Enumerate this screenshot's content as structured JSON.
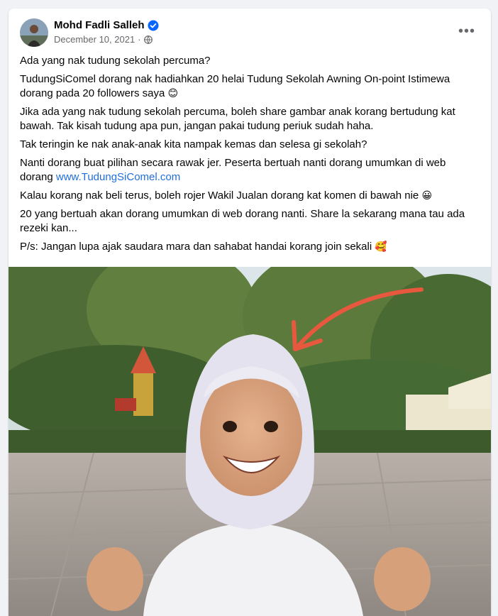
{
  "post": {
    "author": {
      "name": "Mohd Fadli Salleh",
      "verified": true
    },
    "date": "December 10, 2021",
    "privacy_icon": "globe-icon",
    "more_icon": "more-options-icon",
    "more_label": "•••",
    "paragraphs": [
      {
        "text": "Ada yang nak tudung sekolah percuma?"
      },
      {
        "text": "TudungSiComel dorang nak hadiahkan 20 helai Tudung Sekolah Awning On-point Istimewa dorang pada 20 followers saya ",
        "emoji": "😊"
      },
      {
        "text": "Jika ada yang nak tudung sekolah percuma, boleh share gambar anak korang bertudung kat bawah. Tak kisah tudung apa pun, jangan pakai tudung periuk sudah haha."
      },
      {
        "text": "Tak teringin ke nak anak-anak kita nampak kemas dan selesa gi sekolah?"
      },
      {
        "text": "Nanti dorang buat pilihan secara rawak jer. Peserta bertuah nanti dorang umumkan di web dorang ",
        "link": "www.TudungSiComel.com"
      },
      {
        "text": "Kalau korang nak beli terus, boleh rojer Wakil Jualan dorang kat komen di bawah nie ",
        "emoji": "😀"
      },
      {
        "text": "20 yang bertuah akan dorang umumkan di web dorang nanti. Share la sekarang mana tau ada rezeki kan..."
      },
      {
        "text": "P/s: Jangan lupa ajak saudara mara dan sahabat handai korang join sekali ",
        "emoji": "🥰"
      }
    ]
  },
  "colors": {
    "link": "#216fdb",
    "verified_badge": "#0866ff",
    "secondary_text": "#65676b",
    "arrow": "#e8583f"
  }
}
